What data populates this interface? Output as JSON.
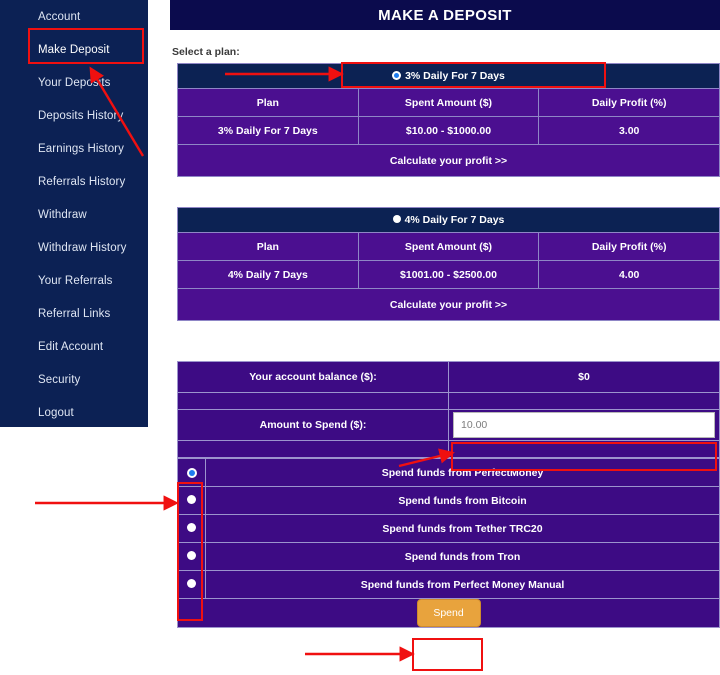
{
  "sidebar": {
    "items": [
      {
        "label": "Account",
        "active": false
      },
      {
        "label": "Make Deposit",
        "active": true
      },
      {
        "label": "Your Deposits",
        "active": false
      },
      {
        "label": "Deposits History",
        "active": false
      },
      {
        "label": "Earnings History",
        "active": false
      },
      {
        "label": "Referrals History",
        "active": false
      },
      {
        "label": "Withdraw",
        "active": false
      },
      {
        "label": "Withdraw History",
        "active": false
      },
      {
        "label": "Your Referrals",
        "active": false
      },
      {
        "label": "Referral Links",
        "active": false
      },
      {
        "label": "Edit Account",
        "active": false
      },
      {
        "label": "Security",
        "active": false
      },
      {
        "label": "Logout",
        "active": false
      }
    ]
  },
  "header": {
    "title": "MAKE A DEPOSIT"
  },
  "main": {
    "select_plan_label": "Select a plan:",
    "columns": [
      "Plan",
      "Spent Amount ($)",
      "Daily Profit (%)"
    ],
    "calculate_link": "Calculate your profit >>",
    "plans": [
      {
        "selector_label": "3% Daily For 7 Days",
        "selected": true,
        "plan": "3% Daily For 7 Days",
        "spent_amount": "$10.00 - $1000.00",
        "daily_profit": "3.00"
      },
      {
        "selector_label": "4% Daily For 7 Days",
        "selected": false,
        "plan": "4% Daily 7 Days",
        "spent_amount": "$1001.00 - $2500.00",
        "daily_profit": "4.00"
      }
    ],
    "account": {
      "balance_label": "Your account balance ($):",
      "balance_value": "$0",
      "amount_label": "Amount to Spend ($):",
      "amount_value": "10.00",
      "amount_placeholder": "10.00"
    },
    "payment_methods": [
      {
        "label": "Spend funds from PerfectMoney",
        "selected": true
      },
      {
        "label": "Spend funds from Bitcoin",
        "selected": false
      },
      {
        "label": "Spend funds from Tether TRC20",
        "selected": false
      },
      {
        "label": "Spend funds from Tron",
        "selected": false
      },
      {
        "label": "Spend funds from Perfect Money Manual",
        "selected": false
      }
    ],
    "spend_button": "Spend"
  },
  "colors": {
    "sidebar_bg": "#0c2154",
    "header_bg": "#0b0b4d",
    "plan_header_bg": "#0c2253",
    "table_purple": "#4b0f90",
    "panel_purple": "#3d0b84",
    "accent_orange": "#e8a33d",
    "radio_blue": "#1f7df0",
    "annotation_red": "#f01010"
  }
}
